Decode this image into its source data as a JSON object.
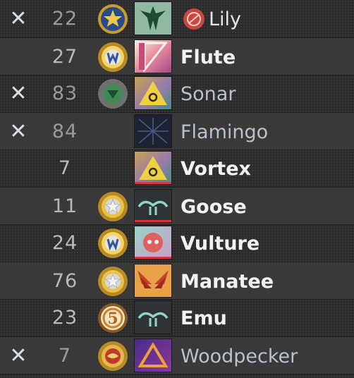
{
  "colors": {
    "text_alive": "#f2f2f2",
    "text_dead": "#b9c2cc",
    "kick_x": "#d8dde6"
  },
  "players": [
    {
      "name": "Lily",
      "number": "22",
      "dead": true,
      "medal": "blue-star-medal-icon",
      "avatar": "green-emblem-avatar",
      "flag": "red-circle-flag-icon"
    },
    {
      "name": "Flute",
      "number": "27",
      "dead": false,
      "medal": "gold-w-medal-icon",
      "avatar": "pink-stripe-avatar"
    },
    {
      "name": "Sonar",
      "number": "83",
      "dead": true,
      "medal": "green-emblem-medal-icon",
      "avatar": "yellow-triangle-avatar"
    },
    {
      "name": "Flamingo",
      "number": "84",
      "dead": true,
      "medal": "",
      "avatar": "dark-starburst-avatar"
    },
    {
      "name": "Vortex",
      "number": "7",
      "dead": false,
      "medal": "",
      "avatar": "yellow-triangle-avatar"
    },
    {
      "name": "Goose",
      "number": "11",
      "dead": false,
      "medal": "gold-star-medal-icon",
      "avatar": "teal-wings-avatar"
    },
    {
      "name": "Vulture",
      "number": "24",
      "dead": false,
      "medal": "gold-w-medal-icon",
      "avatar": "red-circle-avatar"
    },
    {
      "name": "Manatee",
      "number": "76",
      "dead": false,
      "medal": "gold-star-medal-icon",
      "avatar": "orange-wings-avatar"
    },
    {
      "name": "Emu",
      "number": "23",
      "dead": false,
      "medal": "five-year-medal-icon",
      "avatar": "teal-wings-avatar"
    },
    {
      "name": "Woodpecker",
      "number": "7",
      "dead": true,
      "medal": "red-eagle-medal-icon",
      "avatar": "purple-triangle-avatar"
    }
  ],
  "kick_symbol": "✕"
}
